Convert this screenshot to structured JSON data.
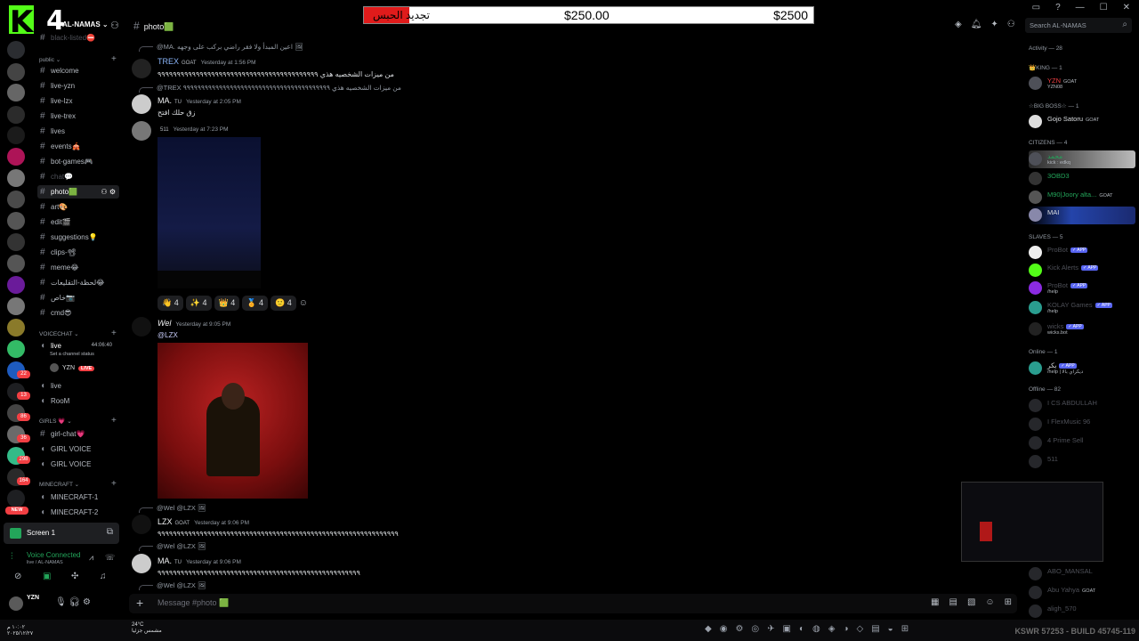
{
  "overlay": {
    "logo_letter": "K",
    "logo_num": "4"
  },
  "server": {
    "name": "AL-NAMAS"
  },
  "header": {
    "channel": "photo🟩"
  },
  "donation": {
    "label": "تجديد الحبس",
    "current": "$250.00",
    "goal": "$2500",
    "progress": 0.1
  },
  "search": {
    "placeholder": "Search AL-NAMAS"
  },
  "rail": {
    "badges": [
      "22",
      "13",
      "86",
      "36",
      "298",
      "164"
    ],
    "new_label": "NEW"
  },
  "channels": {
    "top_muted": "black-listed⛔",
    "public_label": "public",
    "public": [
      "welcome",
      "live-yzn",
      "live-lzx",
      "live-trex",
      "lives",
      "events🎪",
      "bot-games🎮",
      "chat💬",
      "photo🟩",
      "art🎨",
      "edit🎬",
      "suggestions💡",
      "clips-📽",
      "meme😂",
      "لحظة-التقليعات😂",
      "خاص📷",
      "cmd😎"
    ],
    "voicechat_label": "VOICECHAT",
    "live_channel": "live",
    "live_status": "Set a channel status",
    "live_time": "44:06:40",
    "live_user": "YZN",
    "live_badge": "LIVE",
    "voice_channels": [
      "live",
      "RooM"
    ],
    "girls_label": "GIRLS 💗",
    "girls": [
      "girl-chat💗",
      "GIRL VOICE",
      "GIRL VOICE"
    ],
    "minecraft_label": "MINECRAFT",
    "minecraft": [
      "MINECRAFT-1",
      "MINECRAFT-2"
    ]
  },
  "screen_share": {
    "label": "Screen 1"
  },
  "voice": {
    "status": "Voice Connected",
    "channel": "live / AL-NAMAS"
  },
  "user": {
    "name": "YZN"
  },
  "messages": [
    {
      "reply": "@MA.  اعين المبدأ ولا فقر راضي بركب على وجهه 🖼"
    },
    {
      "author": "TREX",
      "tag": "GOAT",
      "time": "Yesterday at 1:56 PM",
      "text": "من ميزات الشخصيه هذي ٩٩٩٩٩٩٩٩٩٩٩٩٩٩٩٩٩٩٩٩٩٩٩٩٩٩٩٩٩٩٩٩٩٩٩٩٩٩٩٩٩٩"
    },
    {
      "reply": "@TREX  من ميزات الشخصيه هذي ٩٩٩٩٩٩٩٩٩٩٩٩٩٩٩٩٩٩٩٩٩٩٩٩٩٩٩٩٩٩٩٩٩٩٩٩٩٩٩٩٩"
    },
    {
      "author": "MA.",
      "tag": "TU",
      "time": "Yesterday at 2:05 PM",
      "text": "زق حلك افتح"
    },
    {
      "author": "",
      "tag": "511",
      "time": "Yesterday at 7:23 PM"
    },
    {
      "author": "Wel",
      "time": "Yesterday at 9:05 PM",
      "text": "@LZX"
    },
    {
      "reply": "@Wel  @LZX 🖼"
    },
    {
      "author": "LZX",
      "tag": "GOAT",
      "time": "Yesterday at 9:06 PM",
      "text": "٩٩٩٩٩٩٩٩٩٩٩٩٩٩٩٩٩٩٩٩٩٩٩٩٩٩٩٩٩٩٩٩٩٩٩٩٩٩٩٩٩٩٩٩٩٩٩٩٩٩٩٩٩٩٩٩٩٩٩٩٩٩٩"
    },
    {
      "reply": "@Wel  @LZX 🖼"
    },
    {
      "author": "MA.",
      "tag": "TU",
      "time": "Yesterday at 9:06 PM",
      "text": "٩٩٩٩٩٩٩٩٩٩٩٩٩٩٩٩٩٩٩٩٩٩٩٩٩٩٩٩٩٩٩٩٩٩٩٩٩٩٩٩٩٩٩٩٩٩٩٩٩٩٩٩٩"
    },
    {
      "reply": "@Wel  @LZX 🖼"
    }
  ],
  "reactions": [
    {
      "emoji": "👋",
      "count": "4"
    },
    {
      "emoji": "✨",
      "count": "4"
    },
    {
      "emoji": "👑",
      "count": "4"
    },
    {
      "emoji": "🏅",
      "count": "4"
    },
    {
      "emoji": "🙂",
      "count": "4"
    }
  ],
  "composer": {
    "placeholder": "Message #photo 🟩"
  },
  "members": {
    "activity": "Activity — 28",
    "king": "👑KING — 1",
    "king_user": "YZN",
    "king_sub": "YZN08",
    "bigboss": "☆BIG BOSS☆ — 1",
    "bigboss_user": "Gojo Satoru",
    "citizens": "CITIZENS — 4",
    "citizen_users": [
      "محمد",
      "3OBD3",
      "M90|Joory alta...",
      "MAI"
    ],
    "citizen_sub": "kick : edkq",
    "slaves": "SLAVES — 5",
    "slave_users": [
      "ProBot",
      "Kick Alerts",
      "ProBot",
      "KOLAY Games",
      "wicks"
    ],
    "slave_subs": [
      "",
      "",
      "/help",
      "/help",
      "wicks.bot"
    ],
    "online": "Online — 1",
    "online_user": "بكر",
    "online_sub": "/help | ديكراي بالا",
    "offline": "Offline — 82",
    "offline_users": [
      "I CS ABDULLAH",
      "I FlexMusic 96",
      "4 Prime Sell",
      "511",
      "ABO_MANSAL",
      "Abu Yahya",
      "aligh_570"
    ]
  },
  "taskbar": {
    "time": "١٠:٠٢ م",
    "date": "٢٠٢٥/١٢/٢٧",
    "weather": "24°C",
    "weather_desc": "مشمس جزئيا",
    "watermark": "KSWR 57253 - BUILD 45745-119"
  }
}
